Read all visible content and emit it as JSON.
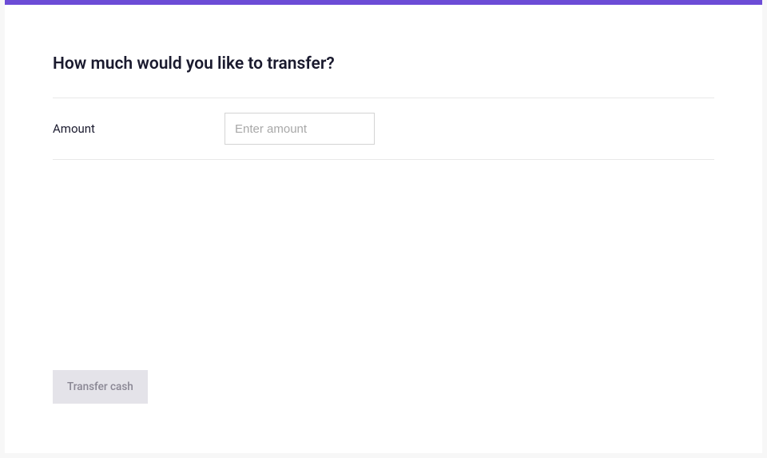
{
  "header": {
    "title": "How much would you like to transfer?"
  },
  "form": {
    "amount": {
      "label": "Amount",
      "placeholder": "Enter amount",
      "value": ""
    }
  },
  "actions": {
    "transfer": {
      "label": "Transfer cash"
    }
  },
  "colors": {
    "accent": "#6c4cd6"
  }
}
